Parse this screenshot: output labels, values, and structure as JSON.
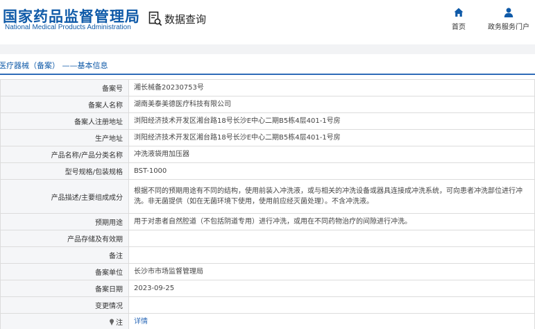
{
  "header": {
    "logo_cn": "国家药品监督管理局",
    "logo_en": "National Medical Products Administration",
    "search_title": "数据查询",
    "nav": [
      {
        "label": "首页",
        "icon": "home-icon"
      },
      {
        "label": "政务服务门户",
        "icon": "user-icon"
      }
    ]
  },
  "page_title": "医疗器械（备案） ——基本信息",
  "rows": [
    {
      "label": "备案号",
      "value": "湘长械备20230753号"
    },
    {
      "label": "备案人名称",
      "value": "湖南美泰美德医疗科技有限公司"
    },
    {
      "label": "备案人注册地址",
      "value": "浏阳经济技术开发区湘台路18号长沙E中心二期B5栋4层401-1号房"
    },
    {
      "label": "生产地址",
      "value": "浏阳经济技术开发区湘台路18号长沙E中心二期B5栋4层401-1号房"
    },
    {
      "label": "产品名称/产品分类名称",
      "value": "冲洗液袋用加压器"
    },
    {
      "label": "型号规格/包装规格",
      "value": "BST-1000"
    },
    {
      "label": "产品描述/主要组成成分",
      "value": "根据不同的预期用途有不同的结构，使用前装入冲洗液，或与相关的冲洗设备或器具连接成冲洗系统，可向患者冲洗部位进行冲洗。非无菌提供（如在无菌环境下使用，使用前应经灭菌处理）。不含冲洗液。"
    },
    {
      "label": "预期用途",
      "value": "用于对患者自然腔道（不包括阴道专用）进行冲洗，或用在不同药物治疗的间隙进行冲洗。"
    },
    {
      "label": "产品存储及有效期",
      "value": ""
    },
    {
      "label": "备注",
      "value": ""
    },
    {
      "label": "备案单位",
      "value": "长沙市市场监督管理局"
    },
    {
      "label": "备案日期",
      "value": "2023-09-25"
    },
    {
      "label": "变更情况",
      "value": ""
    },
    {
      "label": "注",
      "value": "详情"
    }
  ],
  "colors": {
    "brand": "#0f5aa8",
    "link": "#2e6bb8",
    "label_bg": "#f5f6f8"
  }
}
